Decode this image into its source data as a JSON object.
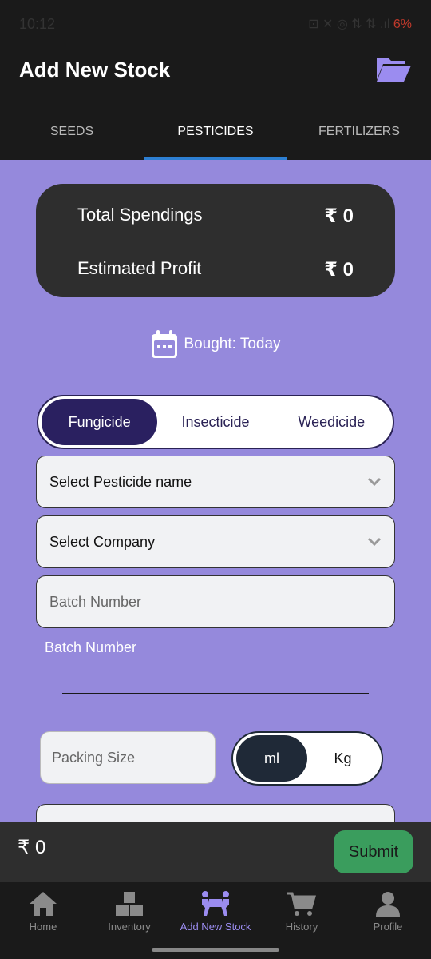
{
  "status": {
    "time": "10:12",
    "indicators": "⊡ ✕ ◎ ⇅ ⇅ .ıl",
    "battery": "6%"
  },
  "appbar": {
    "title": "Add New Stock",
    "action_icon": "folder-open-icon"
  },
  "tabs": [
    {
      "label": "SEEDS",
      "active": false
    },
    {
      "label": "PESTICIDES",
      "active": true
    },
    {
      "label": "FERTILIZERS",
      "active": false
    }
  ],
  "summary": {
    "spend_label": "Total Spendings",
    "spend_value": "₹ 0",
    "profit_label": "Estimated Profit",
    "profit_value": "₹ 0"
  },
  "bought": {
    "text": "Bought: Today",
    "icon": "calendar-icon"
  },
  "type_options": {
    "selected": "Fungicide",
    "items": [
      "Fungicide",
      "Insecticide",
      "Weedicide"
    ]
  },
  "form": {
    "pesticide_select": "Select Pesticide name",
    "company_select": "Select Company",
    "batch_placeholder": "Batch Number",
    "batch_helper": "Batch Number",
    "packing_placeholder": "Packing Size",
    "unit_options": [
      "ml",
      "Kg"
    ],
    "unit_selected": "ml"
  },
  "footer": {
    "total": "₹ 0",
    "submit_label": "Submit"
  },
  "nav": [
    {
      "label": "Home",
      "icon": "home-icon",
      "active": false
    },
    {
      "label": "Inventory",
      "icon": "boxes-icon",
      "active": false
    },
    {
      "label": "Add New Stock",
      "icon": "people-carry-icon",
      "active": true
    },
    {
      "label": "History",
      "icon": "cart-icon",
      "active": false
    },
    {
      "label": "Profile",
      "icon": "user-icon",
      "active": false
    }
  ],
  "colors": {
    "accent": "#9589dc",
    "tab_indicator": "#2d7fd3",
    "submit": "#3a9d5d",
    "segment_selected": "#2a2060"
  }
}
